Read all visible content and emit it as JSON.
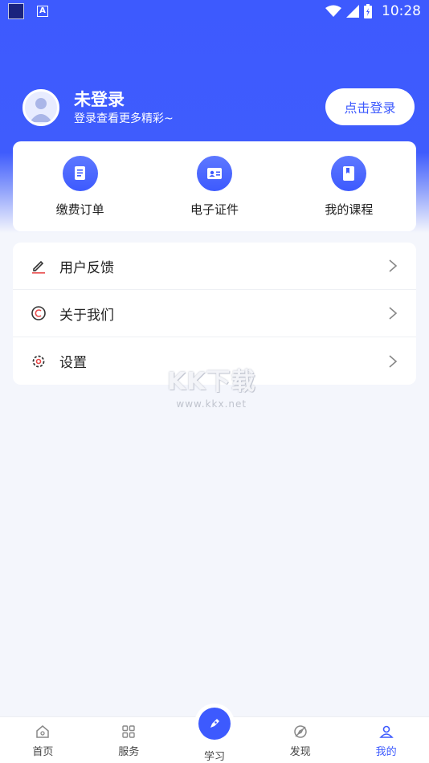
{
  "status_bar": {
    "time": "10:28"
  },
  "profile": {
    "name": "未登录",
    "subtitle": "登录查看更多精彩~",
    "login_button": "点击登录"
  },
  "quick_actions": [
    {
      "label": "缴费订单",
      "icon": "receipt-icon"
    },
    {
      "label": "电子证件",
      "icon": "id-card-icon"
    },
    {
      "label": "我的课程",
      "icon": "course-book-icon"
    }
  ],
  "menu": [
    {
      "label": "用户反馈",
      "icon": "pencil-icon"
    },
    {
      "label": "关于我们",
      "icon": "copyright-icon"
    },
    {
      "label": "设置",
      "icon": "gear-icon"
    }
  ],
  "watermark": {
    "title": "KK下载",
    "url": "www.kkx.net"
  },
  "tabbar": [
    {
      "label": "首页",
      "icon": "home-icon",
      "active": false
    },
    {
      "label": "服务",
      "icon": "grid-icon",
      "active": false
    },
    {
      "label": "学习",
      "icon": "pen-icon",
      "active": false
    },
    {
      "label": "发现",
      "icon": "compass-icon",
      "active": false
    },
    {
      "label": "我的",
      "icon": "user-icon",
      "active": true
    }
  ],
  "colors": {
    "accent": "#3d5afe",
    "background": "#f4f6fc"
  }
}
